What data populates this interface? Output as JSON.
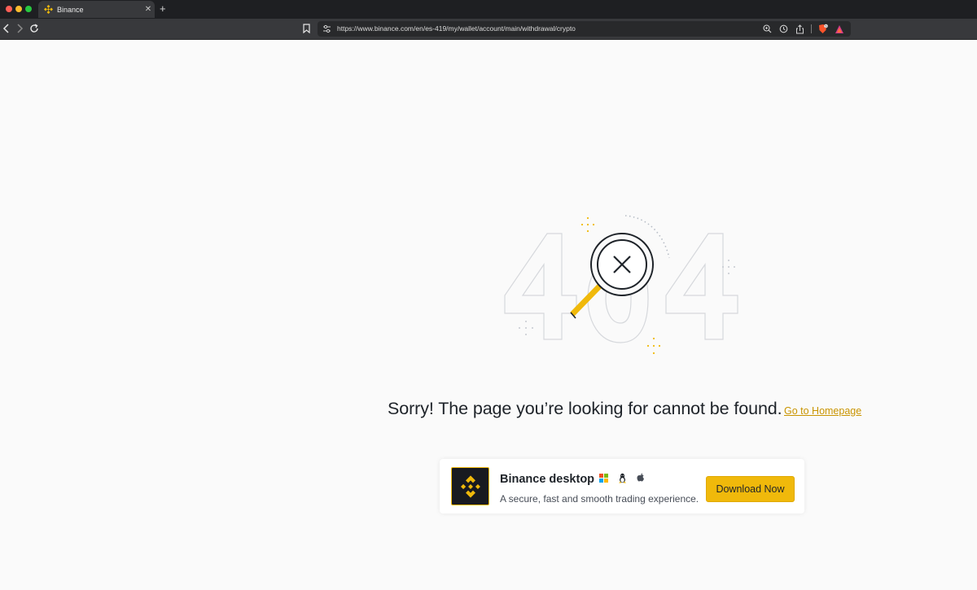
{
  "browser": {
    "tab_title": "Binance",
    "tab_close": "✕",
    "new_tab": "+",
    "url": "https://www.binance.com/en/es-419/my/wallet/account/main/withdrawal/crypto"
  },
  "page": {
    "illustration": {
      "big_text": "404"
    },
    "error_message": "Sorry! The page you’re looking for cannot be found.",
    "homepage_link": "Go to Homepage",
    "download_card": {
      "title": "Binance desktop",
      "subtitle": "A secure, fast and smooth trading experience.",
      "button_label": "Download Now",
      "platform_icons": [
        "windows-icon",
        "linux-icon",
        "apple-icon"
      ]
    }
  },
  "colors": {
    "brand_yellow": "#F0B90B",
    "link_gold": "#C99400",
    "text_dark": "#1E2329",
    "page_bg": "#FAFAFA"
  }
}
